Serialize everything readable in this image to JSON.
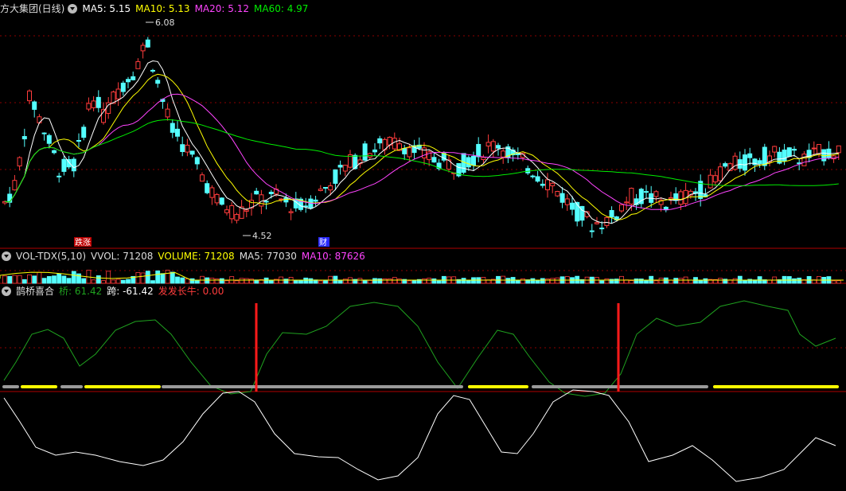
{
  "colors": {
    "up": "#ff3c3c",
    "down": "#54ffff",
    "ma5": "#ffffff",
    "ma10": "#ffff00",
    "ma20": "#ff44ff",
    "ma60": "#00ee00",
    "separator": "#b00000",
    "grid": "#8b0000",
    "osc_green": "#1fa21f",
    "osc_white": "#ffffff",
    "bar_yellow": "#ffff00",
    "bar_gray": "#9a9a9a",
    "signal_red": "#ff1a1a"
  },
  "main_panel": {
    "title": "方大集团(日线)",
    "ma5_label": "MA5: 5.15",
    "ma10_label": "MA10: 5.13",
    "ma20_label": "MA20: 5.12",
    "ma60_label": "MA60: 4.97",
    "high_label": "6.08",
    "low_label": "4.52",
    "marker_1": "跌涨",
    "marker_2": "财"
  },
  "volume_panel": {
    "title": "VOL-TDX(5,10)",
    "vvol_label": "VVOL: 71208",
    "volume_label": "VOLUME: 71208",
    "ma5_label": "MA5: 77030",
    "ma10_label": "MA10: 87626"
  },
  "indicator_panel": {
    "title": "鹊桥喜合",
    "qiao_label": "桥: 61.42",
    "kua_label": "跨: -61.42",
    "fafa_label": "发发长牛: 0.00"
  },
  "chart_data": {
    "type": "candlestick",
    "y_range": [
      4.52,
      6.08
    ],
    "high": 6.08,
    "low": 4.52,
    "ma_last": {
      "MA5": 5.15,
      "MA10": 5.13,
      "MA20": 5.12,
      "MA60": 4.97
    },
    "volume_last": {
      "VVOL": 71208,
      "VOLUME": 71208,
      "MA5": 77030,
      "MA10": 87626
    },
    "indicator_last": {
      "桥": 61.42,
      "跨": -61.42,
      "发发长牛": 0.0
    }
  }
}
